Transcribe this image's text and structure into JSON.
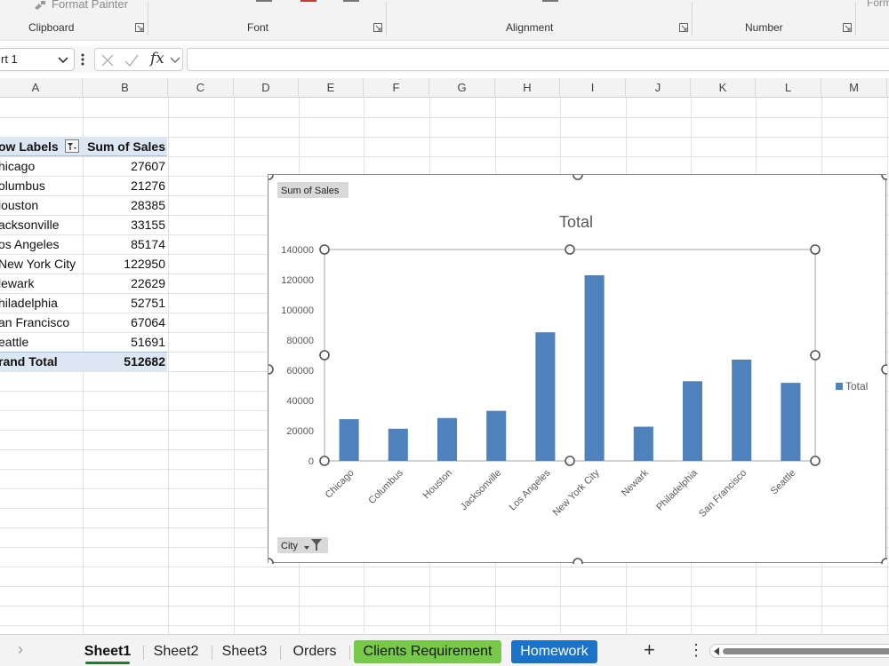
{
  "ribbon": {
    "format_painter": "Format Painter",
    "groups": [
      "Clipboard",
      "Font",
      "Alignment",
      "Number"
    ],
    "partial": "Form"
  },
  "formula_bar": {
    "name_box": "rt 1",
    "fx": "fx",
    "formula": ""
  },
  "columns": [
    "A",
    "B",
    "C",
    "D",
    "E",
    "F",
    "G",
    "H",
    "I",
    "J",
    "K",
    "L",
    "M"
  ],
  "pivot": {
    "header_label": "ow Labels",
    "header_value": "Sum of Sales",
    "rows": [
      {
        "label": "hicago",
        "value": "27607"
      },
      {
        "label": "olumbus",
        "value": "21276"
      },
      {
        "label": "louston",
        "value": "28385"
      },
      {
        "label": "acksonville",
        "value": "33155"
      },
      {
        "label": "os Angeles",
        "value": "85174"
      },
      {
        "label": "New York City",
        "value": "122950"
      },
      {
        "label": "lewark",
        "value": "22629"
      },
      {
        "label": "hiladelphia",
        "value": "52751"
      },
      {
        "label": "an Francisco",
        "value": "67064"
      },
      {
        "label": "eattle",
        "value": "51691"
      }
    ],
    "total_label": "rand Total",
    "total_value": "512682"
  },
  "chart_data": {
    "type": "bar",
    "title": "Total",
    "field_button": "Sum of Sales",
    "axis_field_button": "City",
    "categories": [
      "Chicago",
      "Columbus",
      "Houston",
      "Jacksonville",
      "Los Angeles",
      "New York City",
      "Newark",
      "Philadelphia",
      "San Francisco",
      "Seattle"
    ],
    "series": [
      {
        "name": "Total",
        "values": [
          27607,
          21276,
          28385,
          33155,
          85174,
          122950,
          22629,
          52751,
          67064,
          51691
        ],
        "color": "#4f81bd"
      }
    ],
    "ylim": [
      0,
      140000
    ],
    "yticks": [
      "0",
      "20000",
      "40000",
      "60000",
      "80000",
      "100000",
      "120000",
      "140000"
    ],
    "legend_position": "right",
    "grid": false
  },
  "tabs": [
    {
      "label": "Sheet1",
      "style": "active"
    },
    {
      "label": "Sheet2",
      "style": "plain"
    },
    {
      "label": "Sheet3",
      "style": "plain"
    },
    {
      "label": "Orders",
      "style": "plain"
    },
    {
      "label": "Clients Requirement",
      "style": "green"
    },
    {
      "label": "Homework",
      "style": "blue"
    }
  ],
  "tabbar": {
    "add": "+",
    "more": "⋮",
    "prev": "›"
  }
}
